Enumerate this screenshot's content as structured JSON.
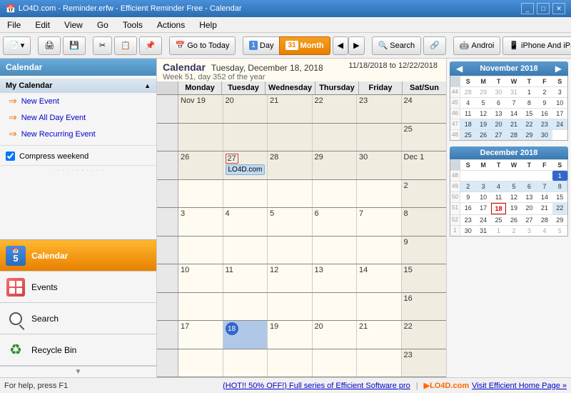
{
  "window": {
    "title": "LO4D.com - Reminder.erfw - Efficient Reminder Free - Calendar",
    "icon": "📅"
  },
  "menu": {
    "items": [
      "File",
      "Edit",
      "View",
      "Go",
      "Tools",
      "Actions",
      "Help"
    ]
  },
  "toolbar": {
    "goto_today": "Go to Today",
    "day_label": "Day",
    "month_label": "Month",
    "search_label": "Search",
    "android_label": "Androi",
    "iphone_label": "iPhone And iPa"
  },
  "sidebar": {
    "header": "Calendar",
    "my_calendar": "My Calendar",
    "new_event": "New Event",
    "new_all_day_event": "New All Day Event",
    "new_recurring_event": "New Recurring Event",
    "compress_weekend": "Compress weekend",
    "nav_items": [
      {
        "id": "calendar",
        "label": "Calendar",
        "active": true
      },
      {
        "id": "events",
        "label": "Events",
        "active": false
      },
      {
        "id": "search",
        "label": "Search",
        "active": false
      },
      {
        "id": "recycle",
        "label": "Recycle Bin",
        "active": false
      }
    ]
  },
  "calendar": {
    "title": "Calendar",
    "current_date": "Tuesday, December 18, 2018",
    "week_info": "Week 51, day 352 of the year",
    "date_range": "11/18/2018 to 12/22/2018",
    "day_headers": [
      "Monday",
      "Tuesday",
      "Wednesday",
      "Thursday",
      "Friday",
      "Sat/Sun"
    ],
    "weeks": [
      {
        "week_num": "",
        "days": [
          {
            "num": "Nov 19",
            "other": true,
            "events": []
          },
          {
            "num": "20",
            "other": true,
            "events": []
          },
          {
            "num": "21",
            "other": true,
            "events": []
          },
          {
            "num": "22",
            "other": true,
            "events": []
          },
          {
            "num": "23",
            "other": true,
            "events": []
          },
          {
            "num": "24",
            "other": true,
            "weekend": true,
            "events": []
          }
        ]
      },
      {
        "week_num": "",
        "days": [
          {
            "num": "",
            "other": true,
            "events": []
          },
          {
            "num": "",
            "other": true,
            "events": []
          },
          {
            "num": "",
            "other": true,
            "events": []
          },
          {
            "num": "",
            "other": true,
            "events": []
          },
          {
            "num": "",
            "other": true,
            "events": []
          },
          {
            "num": "25",
            "other": true,
            "weekend": true,
            "events": []
          }
        ]
      },
      {
        "week_num": "",
        "days": [
          {
            "num": "26",
            "other": true,
            "events": []
          },
          {
            "num": "27",
            "other": true,
            "today_border": true,
            "events": [
              {
                "text": "LO4D.com"
              }
            ]
          },
          {
            "num": "28",
            "other": true,
            "events": []
          },
          {
            "num": "29",
            "other": true,
            "events": []
          },
          {
            "num": "30",
            "other": true,
            "events": []
          },
          {
            "num": "Dec 1",
            "other": false,
            "weekend": true,
            "events": []
          }
        ]
      },
      {
        "week_num": "",
        "days": [
          {
            "num": "",
            "other": false,
            "events": []
          },
          {
            "num": "",
            "other": false,
            "events": []
          },
          {
            "num": "",
            "other": false,
            "events": []
          },
          {
            "num": "",
            "other": false,
            "events": []
          },
          {
            "num": "",
            "other": false,
            "events": []
          },
          {
            "num": "2",
            "other": false,
            "weekend": true,
            "events": []
          }
        ]
      },
      {
        "week_num": "",
        "days": [
          {
            "num": "3",
            "events": []
          },
          {
            "num": "4",
            "events": []
          },
          {
            "num": "5",
            "events": []
          },
          {
            "num": "6",
            "events": []
          },
          {
            "num": "7",
            "events": []
          },
          {
            "num": "8",
            "weekend": true,
            "events": []
          }
        ]
      },
      {
        "week_num": "",
        "days": [
          {
            "num": "",
            "events": []
          },
          {
            "num": "",
            "events": []
          },
          {
            "num": "",
            "events": []
          },
          {
            "num": "",
            "events": []
          },
          {
            "num": "",
            "events": []
          },
          {
            "num": "9",
            "weekend": true,
            "events": []
          }
        ]
      },
      {
        "week_num": "",
        "days": [
          {
            "num": "10",
            "events": []
          },
          {
            "num": "11",
            "events": []
          },
          {
            "num": "12",
            "events": []
          },
          {
            "num": "13",
            "events": []
          },
          {
            "num": "14",
            "events": []
          },
          {
            "num": "15",
            "weekend": true,
            "events": []
          }
        ]
      },
      {
        "week_num": "",
        "days": [
          {
            "num": "",
            "events": []
          },
          {
            "num": "",
            "events": []
          },
          {
            "num": "",
            "events": []
          },
          {
            "num": "",
            "events": []
          },
          {
            "num": "",
            "events": []
          },
          {
            "num": "16",
            "weekend": true,
            "events": []
          }
        ]
      },
      {
        "week_num": "",
        "days": [
          {
            "num": "17",
            "events": []
          },
          {
            "num": "18",
            "today": true,
            "events": []
          },
          {
            "num": "19",
            "events": []
          },
          {
            "num": "20",
            "events": []
          },
          {
            "num": "21",
            "events": []
          },
          {
            "num": "22",
            "weekend": true,
            "events": []
          }
        ]
      },
      {
        "week_num": "",
        "days": [
          {
            "num": "",
            "events": []
          },
          {
            "num": "",
            "events": []
          },
          {
            "num": "",
            "events": []
          },
          {
            "num": "",
            "events": []
          },
          {
            "num": "",
            "events": []
          },
          {
            "num": "23",
            "weekend": true,
            "events": []
          }
        ]
      }
    ]
  },
  "mini_calendars": [
    {
      "month": "November 2018",
      "day_headers": [
        "S",
        "M",
        "T",
        "W",
        "T",
        "F",
        "S"
      ],
      "weeks": [
        {
          "wn": "44",
          "days": [
            {
              "d": "28",
              "o": true
            },
            {
              "d": "29",
              "o": true
            },
            {
              "d": "30",
              "o": true
            },
            {
              "d": "31",
              "o": true
            },
            {
              "d": "1"
            },
            {
              "d": "2"
            },
            {
              "d": "3"
            }
          ]
        },
        {
          "wn": "45",
          "days": [
            {
              "d": "4"
            },
            {
              "d": "5"
            },
            {
              "d": "6"
            },
            {
              "d": "7"
            },
            {
              "d": "8"
            },
            {
              "d": "9"
            },
            {
              "d": "10"
            }
          ]
        },
        {
          "wn": "46",
          "days": [
            {
              "d": "11"
            },
            {
              "d": "12"
            },
            {
              "d": "13"
            },
            {
              "d": "14"
            },
            {
              "d": "15"
            },
            {
              "d": "16"
            },
            {
              "d": "17"
            }
          ]
        },
        {
          "wn": "47",
          "days": [
            {
              "d": "18",
              "hl": true
            },
            {
              "d": "19",
              "hl": true
            },
            {
              "d": "20",
              "hl": true
            },
            {
              "d": "21",
              "hl": true
            },
            {
              "d": "22",
              "hl": true
            },
            {
              "d": "23",
              "hl": true
            },
            {
              "d": "24",
              "hl": true
            }
          ]
        },
        {
          "wn": "48",
          "days": [
            {
              "d": "25",
              "hl": true
            },
            {
              "d": "26",
              "hl": true
            },
            {
              "d": "27",
              "td": true,
              "hl": true
            },
            {
              "d": "28",
              "hl": true
            },
            {
              "d": "29",
              "hl": true
            },
            {
              "d": "30",
              "hl": true
            },
            {
              "d": "",
              "o": true
            }
          ]
        }
      ]
    },
    {
      "month": "December 2018",
      "day_headers": [
        "S",
        "M",
        "T",
        "W",
        "T",
        "F",
        "S"
      ],
      "weeks": [
        {
          "wn": "48",
          "days": [
            {
              "d": ""
            },
            {
              "d": ""
            },
            {
              "d": ""
            },
            {
              "d": ""
            },
            {
              "d": ""
            },
            {
              "d": ""
            },
            {
              "d": "1",
              "sel": true
            }
          ]
        },
        {
          "wn": "49",
          "days": [
            {
              "d": "2",
              "hl": true
            },
            {
              "d": "3",
              "hl": true
            },
            {
              "d": "4",
              "hl": true
            },
            {
              "d": "5",
              "hl": true
            },
            {
              "d": "6",
              "hl": true
            },
            {
              "d": "7",
              "hl": true
            },
            {
              "d": "8",
              "hl": true
            }
          ]
        },
        {
          "wn": "50",
          "days": [
            {
              "d": "9"
            },
            {
              "d": "10"
            },
            {
              "d": "11"
            },
            {
              "d": "12"
            },
            {
              "d": "13"
            },
            {
              "d": "14"
            },
            {
              "d": "15"
            }
          ]
        },
        {
          "wn": "51",
          "days": [
            {
              "d": "16"
            },
            {
              "d": "17"
            },
            {
              "d": "18",
              "today": true
            },
            {
              "d": "19"
            },
            {
              "d": "20"
            },
            {
              "d": "21"
            },
            {
              "d": "22",
              "hl": true
            }
          ]
        },
        {
          "wn": "52",
          "days": [
            {
              "d": "23"
            },
            {
              "d": "24"
            },
            {
              "d": "25"
            },
            {
              "d": "26"
            },
            {
              "d": "27"
            },
            {
              "d": "28"
            },
            {
              "d": "29"
            }
          ]
        },
        {
          "wn": "1",
          "days": [
            {
              "d": "30"
            },
            {
              "d": "31"
            },
            {
              "d": "1",
              "o": true
            },
            {
              "d": "2",
              "o": true
            },
            {
              "d": "3",
              "o": true
            },
            {
              "d": "4",
              "o": true
            },
            {
              "d": "5",
              "o": true
            }
          ]
        }
      ]
    }
  ],
  "status": {
    "help_text": "For help, press F1",
    "promo_text": "(HOT!! 50% OFF!) Full series of Efficient Software pro",
    "visit_text": "Visit Efficient Home Page »"
  }
}
